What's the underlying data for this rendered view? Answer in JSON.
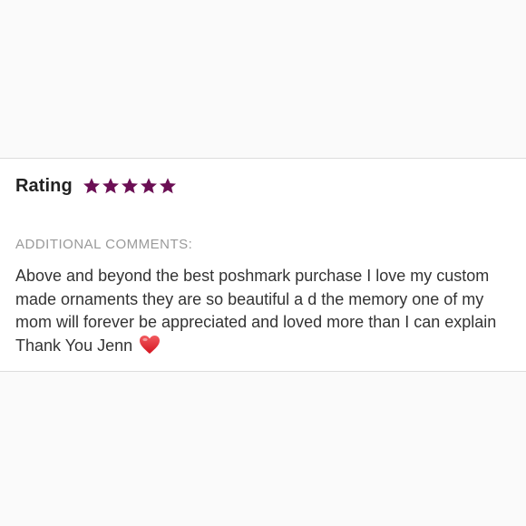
{
  "rating": {
    "label": "Rating",
    "stars": 5,
    "max_stars": 5,
    "star_color": "#6b0f54"
  },
  "comments": {
    "label": "ADDITIONAL COMMENTS:",
    "text": "Above and beyond the best poshmark purchase I love my custom made ornaments they are so beautiful a d the memory one of my mom will forever be appreciated and loved more than I can explain Thank You Jenn",
    "emoji": "heart-icon",
    "emoji_color": "#e0242f"
  }
}
